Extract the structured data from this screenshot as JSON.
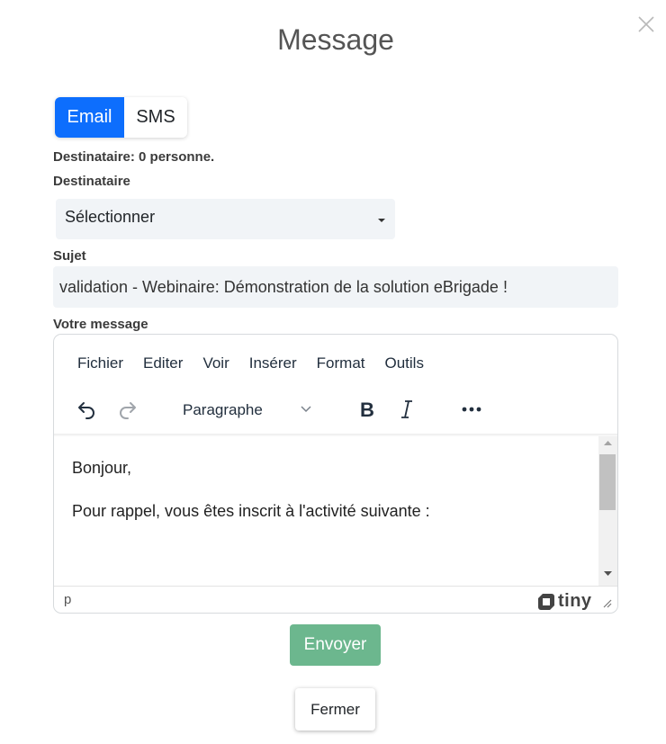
{
  "modal": {
    "title": "Message"
  },
  "tabs": [
    {
      "label": "Email",
      "active": true
    },
    {
      "label": "SMS",
      "active": false
    }
  ],
  "recipient_count_text": "Destinataire: 0 personne.",
  "recipient": {
    "label": "Destinataire",
    "selected": "Sélectionner"
  },
  "subject": {
    "label": "Sujet",
    "value": "validation - Webinaire:  Démonstration de la solution eBrigade !"
  },
  "message": {
    "label": "Votre message"
  },
  "editor": {
    "menu": [
      "Fichier",
      "Editer",
      "Voir",
      "Insérer",
      "Format",
      "Outils"
    ],
    "block_format": "Paragraphe",
    "toolbar_icons": [
      "undo-icon",
      "redo-icon",
      "bold-icon",
      "italic-icon",
      "more-icon"
    ],
    "content": [
      "Bonjour,",
      "Pour rappel, vous êtes inscrit à l'activité suivante :"
    ],
    "status_path": "p",
    "brand": "tiny"
  },
  "actions": {
    "send_label": "Envoyer",
    "close_label": "Fermer"
  },
  "colors": {
    "primary": "#0d6efd",
    "send": "#6cb78e",
    "field_bg": "#f1f4f7"
  }
}
